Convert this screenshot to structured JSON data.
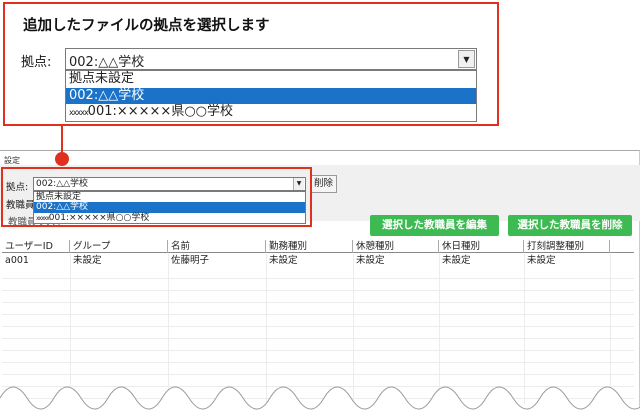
{
  "callout": {
    "title": "追加したファイルの拠点を選択します",
    "label": "拠点:",
    "selected": "002:△△学校",
    "options": [
      {
        "prefix": "",
        "text": "拠点未設定",
        "selected": false
      },
      {
        "prefix": "",
        "text": "002:△△学校",
        "selected": true
      },
      {
        "prefix": "xxxxx",
        "text": "001:×××××県○○学校",
        "selected": false
      }
    ]
  },
  "window": {
    "title": "設定",
    "location_label": "拠点:",
    "location_selected": "002:△△学校",
    "location_options": [
      {
        "prefix": "",
        "text": "拠点未設定",
        "selected": false
      },
      {
        "prefix": "",
        "text": "002:△△学校",
        "selected": true
      },
      {
        "prefix": "xxxxx",
        "text": "001:×××××県○○学校",
        "selected": false
      }
    ],
    "delete_label": "削除",
    "staff_label": "教職員",
    "staff_list_label": "教職員リスト",
    "edit_button": "選択した教職員を編集",
    "delete_staff_button": "選択した教職員を削除"
  },
  "grid": {
    "columns": [
      "ユーザーID",
      "グループ",
      "名前",
      "勤務種別",
      "休憩種別",
      "休日種別",
      "打刻調整種別"
    ],
    "rows": [
      [
        "a001",
        "未設定",
        "佐藤明子",
        "未設定",
        "未設定",
        "未設定",
        "未設定"
      ]
    ]
  },
  "colors": {
    "accent_red": "#e0301e",
    "selection_blue": "#1a73c9",
    "button_green": "#3dbb52"
  }
}
